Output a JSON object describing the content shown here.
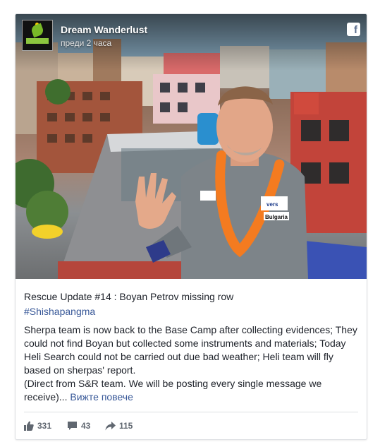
{
  "page": {
    "name": "Dream Wanderlust",
    "time": "преди 2 часа"
  },
  "post": {
    "title": "Rescue Update #14 : Boyan Petrov missing row",
    "hashtag": "#Shishapangma",
    "body_line1": "Sherpa team is now back to the Base Camp after collecting evidences; They could not find Boyan but collected some instruments and materials; Today Heli Search could not be carried out due bad weather; Heli team will fly based on sherpas' report.",
    "body_line2": "(Direct from S&R team. We will be posting every single message we receive)...",
    "see_more": "Вижте повече"
  },
  "stats": {
    "likes": "331",
    "comments": "43",
    "shares": "115"
  },
  "photo": {
    "patch_lines": [
      "vers",
      "Bulgaria"
    ]
  },
  "colors": {
    "link": "#385898",
    "garland": "#f47b20",
    "shirt": "#7d8489"
  },
  "icons": {
    "brand": "facebook-icon",
    "like": "thumbs-up-icon",
    "comment": "comment-icon",
    "share": "share-arrow-icon"
  }
}
